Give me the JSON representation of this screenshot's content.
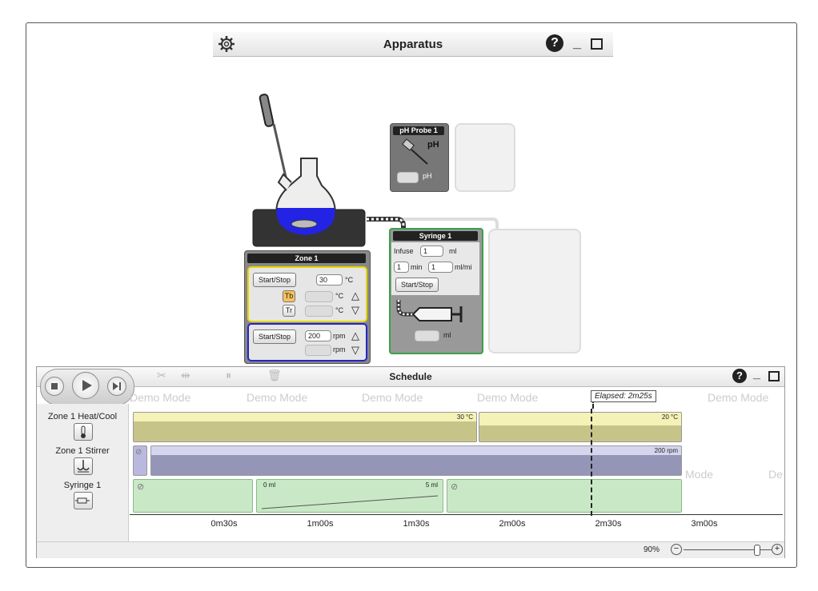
{
  "apparatus": {
    "title": "Apparatus",
    "help": "?",
    "minimize": "_",
    "maximize": "□"
  },
  "ph_probe": {
    "title": "pH Probe 1",
    "symbol": "pH",
    "unit": "pH"
  },
  "zone": {
    "title": "Zone 1",
    "heat": {
      "button": "Start/Stop",
      "setpoint": "30",
      "unit": "°C",
      "tb": "Tb",
      "tr": "Tr"
    },
    "stir": {
      "button": "Start/Stop",
      "setpoint": "200",
      "unit": "rpm"
    }
  },
  "syringe": {
    "title": "Syringe 1",
    "infuse_label": "Infuse",
    "infuse_value": "1",
    "infuse_unit": "ml",
    "time_value": "1",
    "time_unit": "min",
    "rate_value": "1",
    "rate_unit": "ml/mi",
    "button": "Start/Stop",
    "volume_unit": "ml"
  },
  "schedule": {
    "title": "Schedule",
    "help": "?",
    "minimize": "_",
    "maximize": "□",
    "elapsed": "Elapsed: 2m25s",
    "watermark": "Demo Mode",
    "watermark_partial_1": "Mode",
    "watermark_partial_2": "De",
    "lanes": [
      {
        "label": "Zone 1 Heat/Cool",
        "icon": "thermometer-icon"
      },
      {
        "label": "Zone 1 Stirrer",
        "icon": "stirrer-icon"
      },
      {
        "label": "Syringe 1",
        "icon": "syringe-icon"
      }
    ],
    "heat_seg1_label": "30 °C",
    "heat_seg2_label": "20 °C",
    "stir_label": "200 rpm",
    "syringe_start": "0 ml",
    "syringe_end": "5 ml",
    "ticks": [
      "0m30s",
      "1m00s",
      "1m30s",
      "2m00s",
      "2m30s",
      "3m00s"
    ],
    "zoom": "90%"
  },
  "colors": {
    "heat": "#ece9a2",
    "stir": "#b9b9df",
    "syringe": "#c9e9c6",
    "liquid": "#2323e6"
  }
}
